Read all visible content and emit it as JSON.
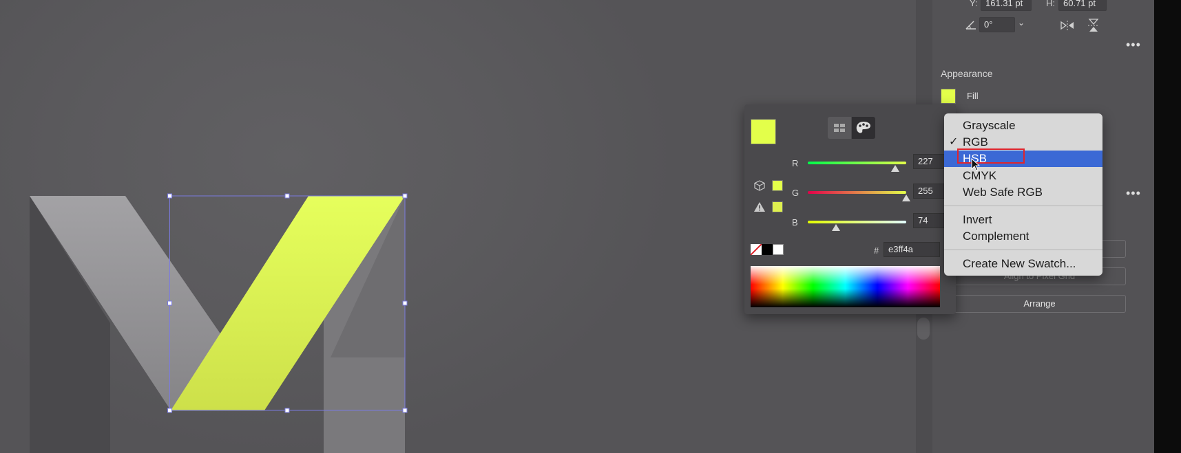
{
  "transform": {
    "y_label": "Y:",
    "y_value": "161.31 pt",
    "h_label": "H:",
    "h_value": "60.71 pt",
    "rotate_value": "0°",
    "rotate_icon": "angle-icon",
    "flip_horizontal_icon": "flip-horizontal-icon",
    "flip_vertical_icon": "flip-vertical-icon"
  },
  "appearance": {
    "title": "Appearance",
    "fill_label": "Fill",
    "fill_color": "#e3ff4a"
  },
  "quick_actions": {
    "align_label": "Align to Pixel Grid",
    "arrange_label": "Arrange"
  },
  "color_picker": {
    "current_color": "#e3ff4a",
    "channels": [
      {
        "name": "R",
        "value": "227",
        "fraction": 0.89
      },
      {
        "name": "G",
        "value": "255",
        "fraction": 1.0
      },
      {
        "name": "B",
        "value": "74",
        "fraction": 0.29
      }
    ],
    "hash_label": "#",
    "hex_value": "e3ff4a",
    "out_of_gamut_icon": "cube-icon",
    "warning_icon": "warning-icon"
  },
  "color_mode_menu": {
    "items": [
      "Grayscale",
      "RGB",
      "HSB",
      "CMYK",
      "Web Safe RGB"
    ],
    "checked": "RGB",
    "highlighted": "HSB",
    "actions": [
      "Invert",
      "Complement"
    ],
    "create_swatch": "Create New Swatch..."
  },
  "colors": {
    "accent": "#3b69d5",
    "selection": "#7a7ae0",
    "shape_gray": "#9a999c",
    "shape_yellow": "#e3ff4a"
  }
}
